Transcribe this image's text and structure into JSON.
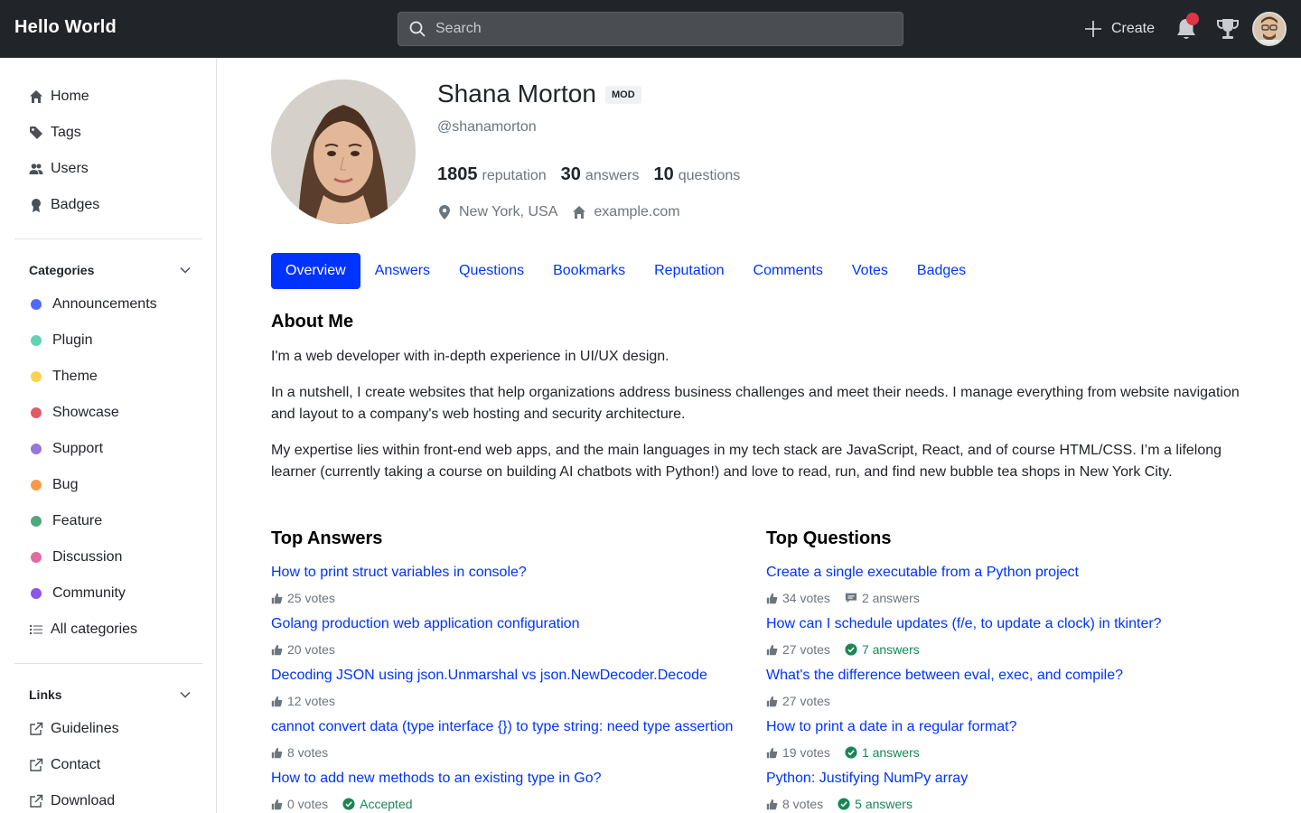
{
  "header": {
    "brand": "Hello World",
    "search_placeholder": "Search",
    "create_label": "Create"
  },
  "sidebar": {
    "main_items": [
      {
        "label": "Home",
        "icon": "home-icon"
      },
      {
        "label": "Tags",
        "icon": "tag-icon"
      },
      {
        "label": "Users",
        "icon": "users-icon"
      },
      {
        "label": "Badges",
        "icon": "badge-icon"
      }
    ],
    "categories_title": "Categories",
    "categories": [
      {
        "label": "Announcements",
        "color": "#4e6cf5"
      },
      {
        "label": "Plugin",
        "color": "#5fd3b4"
      },
      {
        "label": "Theme",
        "color": "#fbd24d"
      },
      {
        "label": "Showcase",
        "color": "#e15a6a"
      },
      {
        "label": "Support",
        "color": "#9678d8"
      },
      {
        "label": "Bug",
        "color": "#f89a4a"
      },
      {
        "label": "Feature",
        "color": "#4fa87c"
      },
      {
        "label": "Discussion",
        "color": "#e06aa3"
      },
      {
        "label": "Community",
        "color": "#8d54e8"
      },
      {
        "label": "All categories",
        "color": ""
      }
    ],
    "links_title": "Links",
    "links": [
      {
        "label": "Guidelines"
      },
      {
        "label": "Contact"
      },
      {
        "label": "Download"
      }
    ]
  },
  "profile": {
    "name": "Shana Morton",
    "badge": "MOD",
    "handle": "@shanamorton",
    "reputation": "1805",
    "reputation_label": "reputation",
    "answers": "30",
    "answers_label": "answers",
    "questions": "10",
    "questions_label": "questions",
    "location": "New York, USA",
    "website": "example.com"
  },
  "tabs": [
    "Overview",
    "Answers",
    "Questions",
    "Bookmarks",
    "Reputation",
    "Comments",
    "Votes",
    "Badges"
  ],
  "about": {
    "title": "About Me",
    "paragraphs": [
      "I'm a web developer with in-depth experience in UI/UX design.",
      "In a nutshell, I create websites that help organizations address business challenges and meet their needs. I manage everything from website navigation and layout to a company's web hosting and security architecture.",
      "My expertise lies within front-end web apps, and the main languages in my tech stack are JavaScript, React, and of course HTML/CSS. I’m a lifelong learner (currently taking a course on building AI chatbots with Python!) and love to read, run, and find new bubble tea shops in New York City."
    ]
  },
  "top_answers": {
    "title": "Top Answers",
    "items": [
      {
        "title": "How to print struct variables in console?",
        "votes": "25 votes",
        "status": ""
      },
      {
        "title": "Golang production web application configuration",
        "votes": "20 votes",
        "status": ""
      },
      {
        "title": "Decoding JSON using json.Unmarshal vs json.NewDecoder.Decode",
        "votes": "12 votes",
        "status": ""
      },
      {
        "title": "cannot convert data (type interface {}) to type string: need type assertion",
        "votes": "8 votes",
        "status": ""
      },
      {
        "title": "How to add new methods to an existing type in Go?",
        "votes": "0 votes",
        "status": "Accepted"
      }
    ]
  },
  "top_questions": {
    "title": "Top Questions",
    "items": [
      {
        "title": "Create a single executable from a Python project",
        "votes": "34 votes",
        "answers": "2 answers",
        "accepted": false
      },
      {
        "title": "How can I schedule updates (f/e, to update a clock) in tkinter?",
        "votes": "27 votes",
        "answers": "7 answers",
        "accepted": true
      },
      {
        "title": "What's the difference between eval, exec, and compile?",
        "votes": "27 votes",
        "answers": "",
        "accepted": false
      },
      {
        "title": "How to print a date in a regular format?",
        "votes": "19 votes",
        "answers": "1 answers",
        "accepted": true
      },
      {
        "title": "Python: Justifying NumPy array",
        "votes": "8 votes",
        "answers": "5 answers",
        "accepted": true
      }
    ]
  }
}
